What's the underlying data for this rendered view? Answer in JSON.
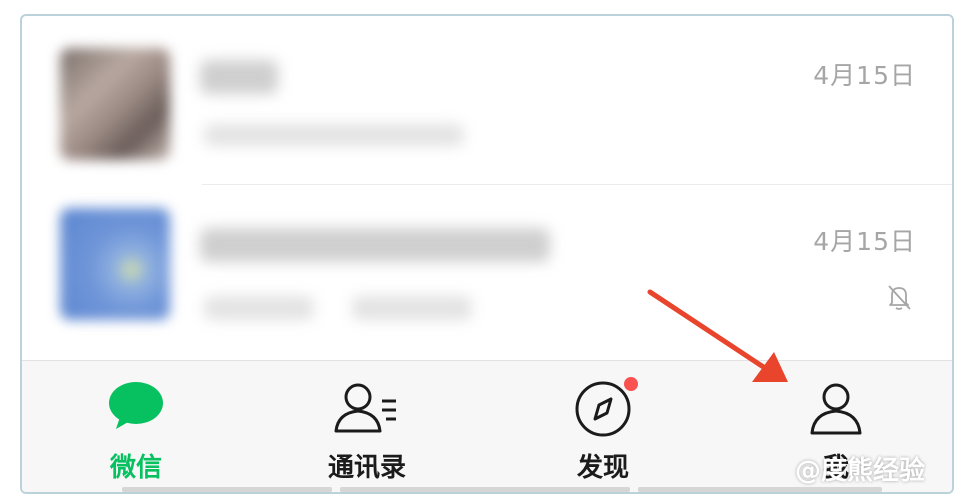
{
  "chats": [
    {
      "timestamp": "4月15日",
      "muted": false
    },
    {
      "timestamp": "4月15日",
      "muted": true
    }
  ],
  "tabbar": {
    "tabs": [
      {
        "label": "微信",
        "icon": "chat-bubble-icon",
        "active": true
      },
      {
        "label": "通讯录",
        "icon": "contacts-icon",
        "active": false
      },
      {
        "label": "发现",
        "icon": "compass-icon",
        "active": false,
        "badge": "red-dot"
      },
      {
        "label": "我",
        "icon": "person-icon",
        "active": false
      }
    ]
  },
  "annotation": {
    "arrow_color": "#e8452c"
  },
  "watermark": {
    "text": "@度熊经验"
  },
  "colors": {
    "accent": "#07c160",
    "badge": "#fa5151",
    "timestamp": "#a6a6a6"
  }
}
